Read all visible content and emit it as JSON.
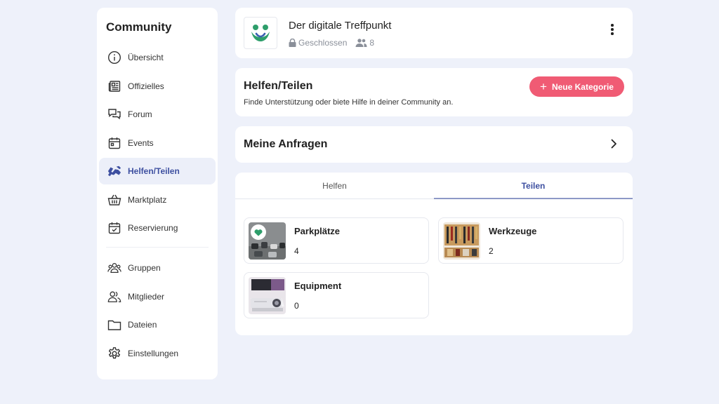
{
  "sidebar": {
    "title": "Community",
    "items": [
      {
        "label": "Übersicht",
        "icon": "info-icon"
      },
      {
        "label": "Offizielles",
        "icon": "newspaper-icon"
      },
      {
        "label": "Forum",
        "icon": "chat-icon"
      },
      {
        "label": "Events",
        "icon": "calendar-icon"
      },
      {
        "label": "Helfen/Teilen",
        "icon": "handshake-icon",
        "active": true
      },
      {
        "label": "Marktplatz",
        "icon": "basket-icon"
      },
      {
        "label": "Reservierung",
        "icon": "calendar-check-icon"
      }
    ],
    "items2": [
      {
        "label": "Gruppen",
        "icon": "groups-icon"
      },
      {
        "label": "Mitglieder",
        "icon": "members-icon"
      },
      {
        "label": "Dateien",
        "icon": "folder-icon"
      },
      {
        "label": "Einstellungen",
        "icon": "gear-icon"
      }
    ]
  },
  "group": {
    "name": "Der digitale Treffpunkt",
    "privacy": "Geschlossen",
    "members": "8"
  },
  "intro": {
    "title": "Helfen/Teilen",
    "subtitle": "Finde Unterstützung oder biete Hilfe in deiner Community an.",
    "button_label": "Neue Kategorie"
  },
  "requests": {
    "title": "Meine Anfragen"
  },
  "tabs": [
    {
      "label": "Helfen"
    },
    {
      "label": "Teilen",
      "active": true
    }
  ],
  "categories": [
    {
      "name": "Parkplätze",
      "count": "4",
      "icon": "parking-thumbnail"
    },
    {
      "name": "Werkzeuge",
      "count": "2",
      "icon": "tools-thumbnail"
    },
    {
      "name": "Equipment",
      "count": "0",
      "icon": "projector-thumbnail"
    }
  ],
  "colors": {
    "accent": "#3d4fa0",
    "button": "#f05b74",
    "background": "#eef1fa",
    "logo_green": "#2e9e6b"
  }
}
